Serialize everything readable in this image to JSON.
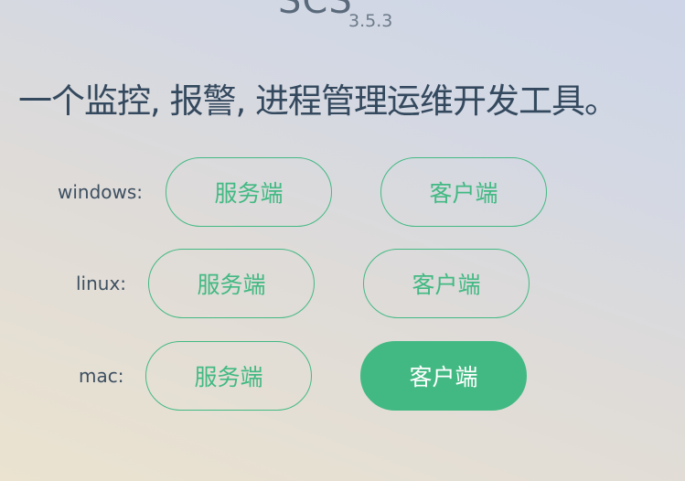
{
  "header": {
    "title": "SCS",
    "version": "3.5.3"
  },
  "tagline": "一个监控, 报警, 进程管理运维开发工具。",
  "colors": {
    "accent": "#42b983",
    "text": "#34495e"
  },
  "platforms": [
    {
      "label": "windows:",
      "server": "服务端",
      "client": "客户端"
    },
    {
      "label": "linux:",
      "server": "服务端",
      "client": "客户端"
    },
    {
      "label": "mac:",
      "server": "服务端",
      "client": "客户端"
    }
  ]
}
